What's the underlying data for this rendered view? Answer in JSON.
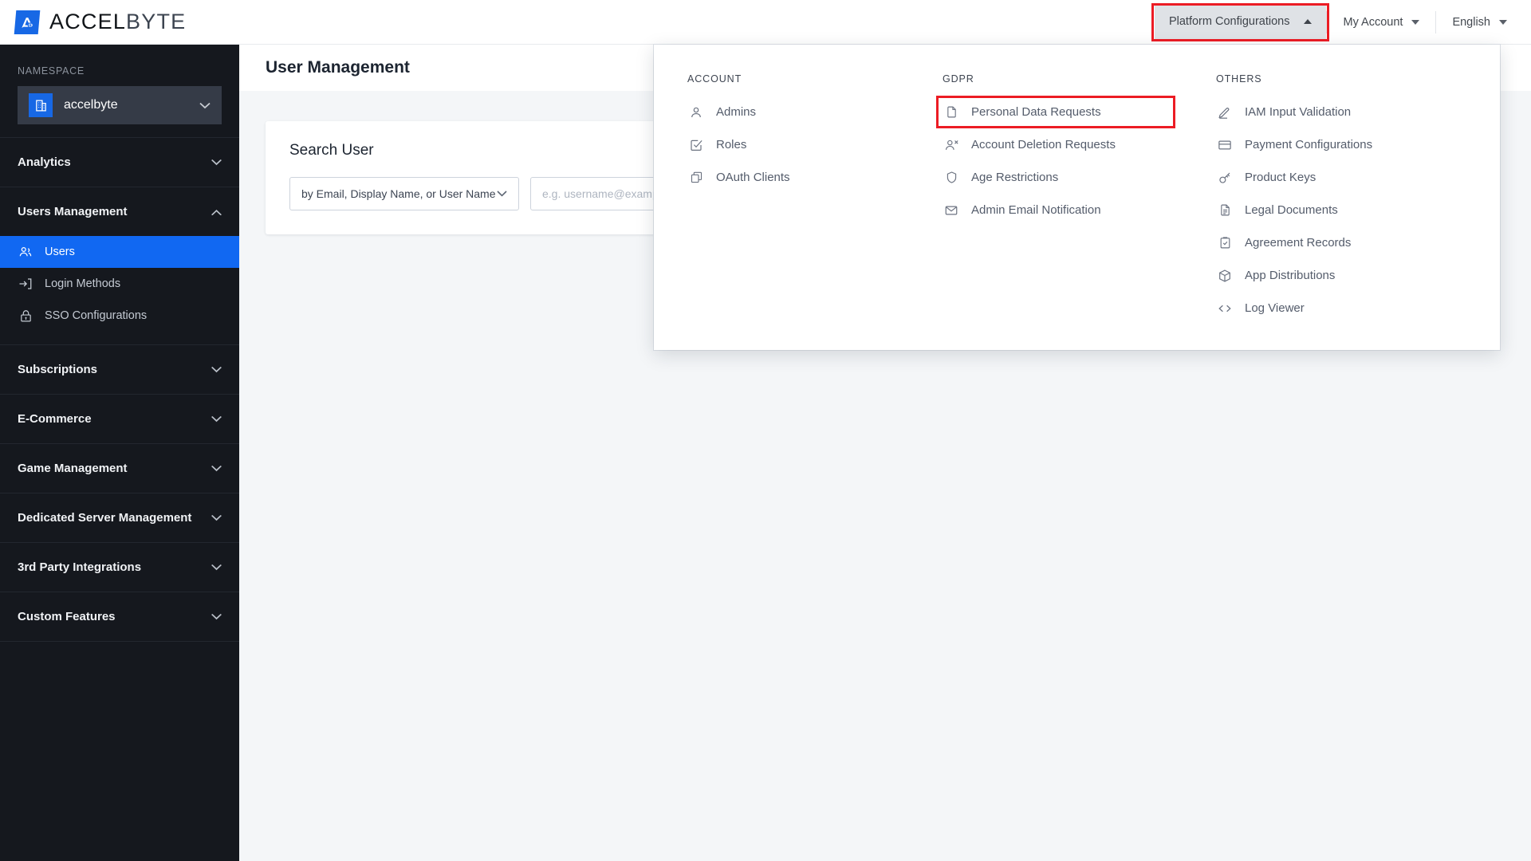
{
  "brand": {
    "name_part1": "ACCEL",
    "name_part2": "BYTE",
    "logo_icon": "accelbyte-logo-icon"
  },
  "topbar": {
    "platform_configurations": {
      "label": "Platform Configurations",
      "icon": "chevron-up-icon",
      "highlighted": true,
      "highlight_color": "#ec1c24"
    },
    "my_account": {
      "label": "My Account",
      "icon": "chevron-down-icon"
    },
    "language": {
      "label": "English",
      "icon": "chevron-down-icon"
    }
  },
  "sidebar": {
    "namespace_label": "NAMESPACE",
    "namespace_value": "accelbyte",
    "namespace_icon": "building-icon",
    "namespace_caret": "chevron-down-icon",
    "groups": [
      {
        "label": "Analytics",
        "caret": "chevron-down-icon",
        "expanded": false,
        "items": []
      },
      {
        "label": "Users Management",
        "caret": "chevron-up-icon",
        "expanded": true,
        "items": [
          {
            "label": "Users",
            "icon": "users-icon",
            "active": true
          },
          {
            "label": "Login Methods",
            "icon": "login-arrow-icon",
            "active": false
          },
          {
            "label": "SSO Configurations",
            "icon": "lock-icon",
            "active": false
          }
        ]
      },
      {
        "label": "Subscriptions",
        "caret": "chevron-down-icon",
        "expanded": false,
        "items": []
      },
      {
        "label": "E-Commerce",
        "caret": "chevron-down-icon",
        "expanded": false,
        "items": []
      },
      {
        "label": "Game Management",
        "caret": "chevron-down-icon",
        "expanded": false,
        "items": []
      },
      {
        "label": "Dedicated Server Management",
        "caret": "chevron-down-icon",
        "expanded": false,
        "items": []
      },
      {
        "label": "3rd Party Integrations",
        "caret": "chevron-down-icon",
        "expanded": false,
        "items": []
      },
      {
        "label": "Custom Features",
        "caret": "chevron-down-icon",
        "expanded": false,
        "items": []
      }
    ]
  },
  "main": {
    "page_title": "User Management",
    "search_card": {
      "heading": "Search User",
      "filter_select_value": "by Email, Display Name, or User Name",
      "filter_select_icon": "chevron-down-icon",
      "search_placeholder": "e.g. username@example.com"
    }
  },
  "mega_menu": {
    "columns": [
      {
        "heading": "ACCOUNT",
        "items": [
          {
            "label": "Admins",
            "icon": "person-icon"
          },
          {
            "label": "Roles",
            "icon": "checkbox-icon"
          },
          {
            "label": "OAuth Clients",
            "icon": "copy-icon"
          }
        ]
      },
      {
        "heading": "GDPR",
        "items": [
          {
            "label": "Personal Data Requests",
            "icon": "file-icon",
            "highlighted": true
          },
          {
            "label": "Account Deletion Requests",
            "icon": "person-remove-icon"
          },
          {
            "label": "Age Restrictions",
            "icon": "shield-icon"
          },
          {
            "label": "Admin Email Notification",
            "icon": "mail-icon"
          }
        ]
      },
      {
        "heading": "OTHERS",
        "items": [
          {
            "label": "IAM Input Validation",
            "icon": "pencil-icon"
          },
          {
            "label": "Payment Configurations",
            "icon": "credit-card-icon"
          },
          {
            "label": "Product Keys",
            "icon": "key-icon"
          },
          {
            "label": "Legal Documents",
            "icon": "document-icon"
          },
          {
            "label": "Agreement Records",
            "icon": "clipboard-check-icon"
          },
          {
            "label": "App Distributions",
            "icon": "box-icon"
          },
          {
            "label": "Log Viewer",
            "icon": "code-icon"
          }
        ]
      }
    ]
  },
  "colors": {
    "accent_blue": "#1168f2",
    "highlight_red": "#ec1c24",
    "sidebar_bg": "#15181e",
    "page_bg": "#f4f6f8"
  }
}
